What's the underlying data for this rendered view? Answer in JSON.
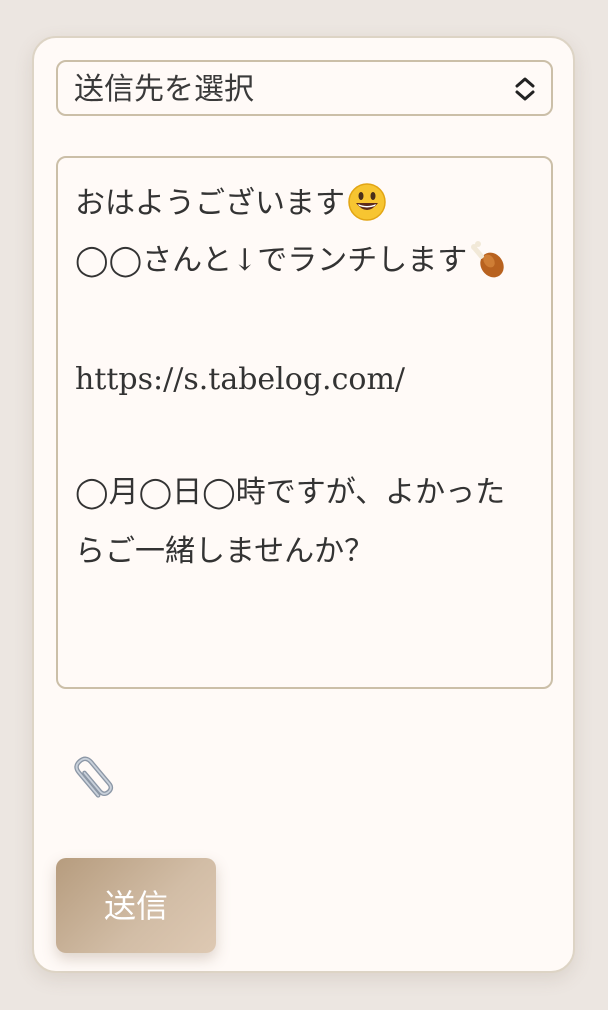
{
  "recipient_select": {
    "selected": "送信先を選択",
    "chevron_icon": "chevron-up-down-icon"
  },
  "message": {
    "lines": [
      "おはようございます",
      "◯◯さんと↓でランチします",
      "",
      "https://s.tabelog.com/",
      "",
      "◯月◯日◯時ですが、よかった",
      "らご一緒しませんか？"
    ],
    "emoji": {
      "line1": "smiling-face-emoji",
      "line2": "poultry-leg-emoji"
    }
  },
  "attachment": {
    "icon": "paperclip-icon"
  },
  "send_button": {
    "label": "送信"
  },
  "colors": {
    "background": "#ece6e1",
    "card": "#fffaf7",
    "border": "#cbbfa8",
    "button_start": "#b69c7e",
    "button_end": "#dec9b3"
  }
}
